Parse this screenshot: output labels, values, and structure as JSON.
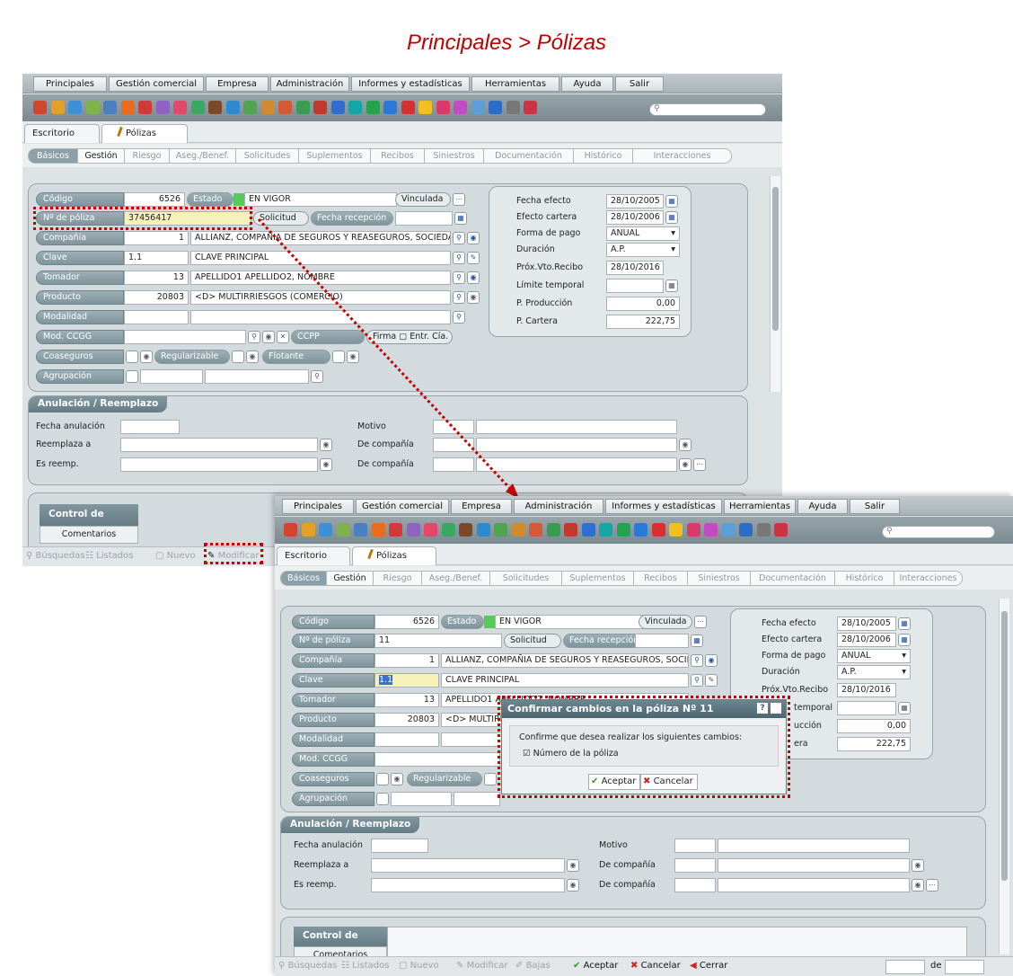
{
  "page_title": "Principales > Pólizas",
  "menu": [
    "Principales",
    "Gestión comercial",
    "Empresa",
    "Administración",
    "Informes y estadísticas",
    "Herramientas",
    "Ayuda",
    "Salir"
  ],
  "window_tabs": {
    "escritorio": "Escritorio",
    "polizas": "Pólizas"
  },
  "subtabs": [
    "Básicos",
    "Gestión",
    "Riesgo",
    "Aseg./Benef.",
    "Solicitudes",
    "Suplementos",
    "Recibos",
    "Siniestros",
    "Documentación",
    "Histórico",
    "Interacciones"
  ],
  "toolbar_icon_colors": [
    "#d1452e",
    "#e2a02a",
    "#3d8fd6",
    "#7fb34a",
    "#4a7fc2",
    "#e86b1e",
    "#d23a3a",
    "#8f63c4",
    "#e04a68",
    "#3aa860",
    "#7a4a2a",
    "#2c8ad1",
    "#4fa54f",
    "#d18a2c",
    "#d25a34",
    "#3b9b53",
    "#c0392b",
    "#2f6fd1",
    "#16a5a5",
    "#24a34f",
    "#2b79d6",
    "#d63030",
    "#f0c020",
    "#d93a6a",
    "#c24bc4",
    "#5a9fd6",
    "#2a6ec7",
    "#777777",
    "#cc3344"
  ],
  "form_a": {
    "codigo_label": "Código",
    "codigo_value": "6526",
    "estado_label": "Estado",
    "estado_value": "EN VIGOR",
    "vinculada": "Vinculada",
    "poliza_label": "Nº de póliza",
    "poliza_value": "37456417",
    "solicitud": "Solicitud",
    "fecha_recepcion": "Fecha recepción",
    "compania_label": "Compañía",
    "compania_code": "1",
    "compania_value": "ALLIANZ, COMPAÑIA DE SEGUROS Y REASEGUROS, SOCIEDAD A",
    "clave_label": "Clave",
    "clave_code": "1.1",
    "clave_value": "CLAVE PRINCIPAL",
    "tomador_label": "Tomador",
    "tomador_code": "13",
    "tomador_value": "APELLIDO1 APELLIDO2, NOMBRE",
    "producto_label": "Producto",
    "producto_code": "20803",
    "producto_value": "<D> MULTIRRIESGOS (COMERCIO)",
    "modalidad_label": "Modalidad",
    "mod_cccg_label": "Mod. CCGG",
    "ccpp": "CCPP",
    "firma": "Firma",
    "entr_cia": "Entr. Cía.",
    "coaseguros_label": "Coaseguros",
    "regularizable": "Regularizable",
    "flotante": "Flotante",
    "agrupacion_label": "Agrupación"
  },
  "dates_a": {
    "fecha_efecto_label": "Fecha efecto",
    "fecha_efecto": "28/10/2005",
    "efecto_cartera_label": "Efecto cartera",
    "efecto_cartera": "28/10/2006",
    "forma_pago_label": "Forma de pago",
    "forma_pago": "ANUAL",
    "duracion_label": "Duración",
    "duracion": "A.P.",
    "prox_vto_label": "Próx.Vto.Recibo",
    "prox_vto": "28/10/2016",
    "limite_label": "Límite temporal",
    "p_produccion_label": "P. Producción",
    "p_produccion": "0,00",
    "p_cartera_label": "P. Cartera",
    "p_cartera": "222,75"
  },
  "anulacion": {
    "title": "Anulación / Reemplazo",
    "fecha_anulacion": "Fecha anulación",
    "motivo": "Motivo",
    "reemplaza_a": "Reemplaza a",
    "de_compania": "De compañía",
    "es_reemp": "Es reemp."
  },
  "control": {
    "control_gestion": "Control de gestión",
    "comentarios": "Comentarios"
  },
  "bottom_a": [
    "Búsquedas",
    "Listados",
    "Nuevo",
    "Modificar"
  ],
  "form_b": {
    "poliza_value": "11",
    "clave_code": "1.1",
    "p_fragment_1": "ucción",
    "p_fragment_2": "era",
    "limite_fragment": "temporal",
    "tomador_fragment": "APELLIDO1 APELLIDO2, NOMBRE",
    "producto_fragment": "<D> MULTIRR"
  },
  "dialog": {
    "title": "Confirmar cambios en la póliza Nº 11",
    "message": "Confirme que desea realizar los siguientes cambios:",
    "item": "Número de la póliza",
    "accept": "Aceptar",
    "cancel": "Cancelar"
  },
  "bottom_b": [
    "Búsquedas",
    "Listados",
    "Nuevo",
    "Modificar",
    "Bajas",
    "Aceptar",
    "Cancelar",
    "Cerrar"
  ],
  "pager_de": "de"
}
